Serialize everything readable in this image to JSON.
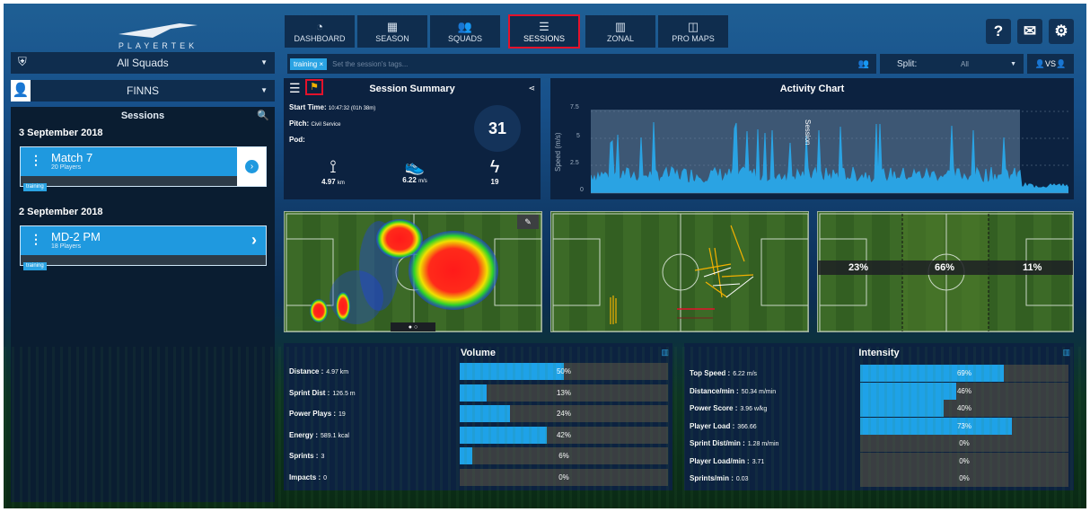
{
  "brand": "PLAYERTEK",
  "nav": [
    {
      "label": "DASHBOARD",
      "icon": "dashboard-gauge-icon"
    },
    {
      "label": "SEASON",
      "icon": "calendar-icon"
    },
    {
      "label": "SQUADS",
      "icon": "squads-icon"
    },
    {
      "label": "SESSIONS",
      "icon": "list-icon"
    },
    {
      "label": "ZONAL",
      "icon": "bar-chart-icon"
    },
    {
      "label": "PRO MAPS",
      "icon": "pro-maps-icon"
    }
  ],
  "selected_tab": "SESSIONS",
  "top_buttons": [
    "help-icon",
    "mail-icon",
    "gear-icon"
  ],
  "squad_select": "All Squads",
  "player_select": "FINNS",
  "sessions": {
    "title": "Sessions",
    "groups": [
      {
        "date": "3 September 2018",
        "name": "Match 7",
        "players": "20 Players",
        "tag": "training"
      },
      {
        "date": "2 September 2018",
        "name": "MD-2 PM",
        "players": "18 Players",
        "tag": "training"
      }
    ]
  },
  "tags": {
    "chip": "training",
    "placeholder": "Set the session's tags..."
  },
  "split": {
    "label": "Split:",
    "value": "All"
  },
  "vs_label": "VS",
  "summary": {
    "title": "Session Summary",
    "start_label": "Start Time:",
    "start_value": "10:47:32 (01h 38m)",
    "pitch_label": "Pitch:",
    "pitch_value": "Civil Service",
    "pod_label": "Pod:",
    "score": "31",
    "stats": [
      {
        "value": "4.97",
        "unit": "km",
        "icon": "distance-pin-icon"
      },
      {
        "value": "6.22",
        "unit": "m/s",
        "icon": "boot-icon"
      },
      {
        "value": "19",
        "unit": "",
        "icon": "lightning-icon"
      }
    ]
  },
  "activity": {
    "title": "Activity Chart",
    "ylabel": "Speed (m/s)",
    "yticks": [
      "7.5",
      "5",
      "2.5",
      "0"
    ],
    "marker": "Session"
  },
  "zones": [
    "23%",
    "66%",
    "11%"
  ],
  "volume": {
    "title": "Volume",
    "rows": [
      {
        "label": "Distance :",
        "value": "4.97 km",
        "pct": "50%",
        "frac": 0.5
      },
      {
        "label": "Sprint Dist :",
        "value": "126.5 m",
        "pct": "13%",
        "frac": 0.13
      },
      {
        "label": "Power Plays :",
        "value": "19",
        "pct": "24%",
        "frac": 0.24
      },
      {
        "label": "Energy :",
        "value": "589.1 kcal",
        "pct": "42%",
        "frac": 0.42
      },
      {
        "label": "Sprints :",
        "value": "3",
        "pct": "6%",
        "frac": 0.06
      },
      {
        "label": "Impacts :",
        "value": "0",
        "pct": "0%",
        "frac": 0
      }
    ]
  },
  "intensity": {
    "title": "Intensity",
    "rows": [
      {
        "label": "Top Speed :",
        "value": "6.22 m/s",
        "pct": "69%",
        "frac": 0.69
      },
      {
        "label": "Distance/min :",
        "value": "50.34 m/min",
        "pct": "46%",
        "frac": 0.46
      },
      {
        "label": "Power Score :",
        "value": "3.96 w/kg",
        "pct": "40%",
        "frac": 0.4
      },
      {
        "label": "Player Load :",
        "value": "366.66",
        "pct": "73%",
        "frac": 0.73
      },
      {
        "label": "Sprint Dist/min :",
        "value": "1.28 m/min",
        "pct": "0%",
        "frac": 0
      },
      {
        "label": "Player Load/min :",
        "value": "3.71",
        "pct": "0%",
        "frac": 0
      },
      {
        "label": "Sprints/min :",
        "value": "0.03",
        "pct": "0%",
        "frac": 0
      }
    ]
  },
  "colors": {
    "accent": "#1ea2e8",
    "highlight": "#e3122b"
  }
}
